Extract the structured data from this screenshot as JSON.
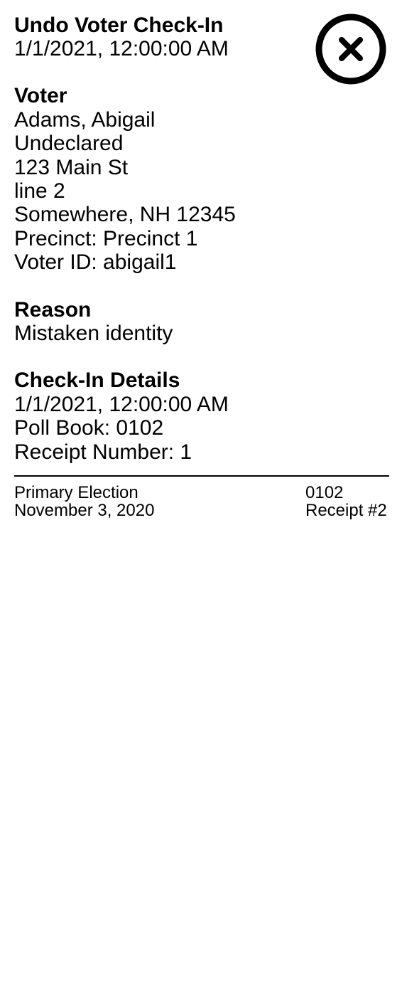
{
  "header": {
    "title": "Undo Voter Check-In",
    "timestamp": "1/1/2021, 12:00:00 AM",
    "close_icon": "close-circle-icon"
  },
  "voter": {
    "heading": "Voter",
    "name": "Adams, Abigail",
    "party": "Undeclared",
    "address_line1": "123 Main St",
    "address_line2": "line 2",
    "city_state_zip": "Somewhere, NH 12345",
    "precinct": "Precinct: Precinct 1",
    "voter_id": "Voter ID: abigail1"
  },
  "reason": {
    "heading": "Reason",
    "text": "Mistaken identity"
  },
  "checkin_details": {
    "heading": "Check-In Details",
    "timestamp": "1/1/2021, 12:00:00 AM",
    "poll_book": "Poll Book: 0102",
    "receipt_number": "Receipt Number: 1"
  },
  "footer": {
    "election_name": "Primary Election",
    "election_date": "November 3, 2020",
    "poll_book_id": "0102",
    "receipt": "Receipt #2"
  }
}
